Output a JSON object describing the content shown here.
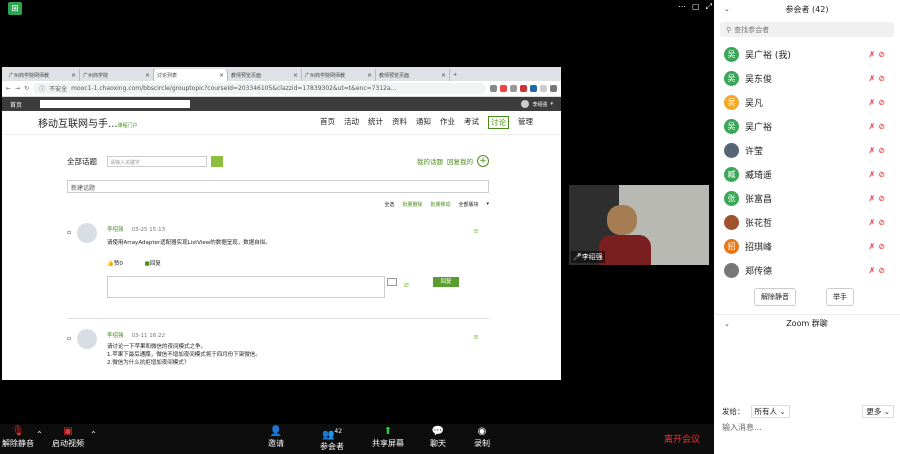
{
  "window": {
    "title_icon": "⊞",
    "controls": [
      "⋯",
      "▢",
      "⤢",
      "⛶"
    ]
  },
  "browser": {
    "tabs": [
      {
        "label": "广州商学院网师教",
        "active": false
      },
      {
        "label": "广州商学院",
        "active": false
      },
      {
        "label": "讨论列表",
        "active": true
      },
      {
        "label": "教师预览页面",
        "active": false
      },
      {
        "label": "广州商学院网师教",
        "active": false
      },
      {
        "label": "教师预览页面",
        "active": false
      }
    ],
    "new_tab": "+",
    "insecure_label": "不安全",
    "url": "mooc1-1.chaoxing.com/bbscircle/grouptopic?courseId=203346105&clazzid=17839302&ut=t&enc=7312a...",
    "site_nav": {
      "home": "首页",
      "user": "李绍强"
    }
  },
  "course": {
    "title": "移动互联网与手...",
    "portal": "课程门户",
    "nav": [
      "首页",
      "活动",
      "统计",
      "资料",
      "通知",
      "作业",
      "考试",
      "讨论",
      "管理"
    ],
    "active_nav": "讨论"
  },
  "discussion": {
    "all_topics": "全部话题",
    "keyword_placeholder": "请输入关键字",
    "my_topics": "我的话题",
    "my_replies": "回复我的",
    "new_topic": "新建话题",
    "select_all": "全选",
    "batch_delete": "批量删除",
    "batch_move": "批量移动",
    "all_sections": "全部版块",
    "reply_btn": "回复",
    "posts": [
      {
        "author": "李绍强",
        "time": "03-25 15:13",
        "text": [
          "请使用ArrayAdapter适配器实现ListView的数据呈现，数据自拟。"
        ],
        "like": "赞0",
        "reply": "回复"
      },
      {
        "author": "李绍强",
        "time": "03-11 16:22",
        "text": [
          "请讨论一下苹果和微信的夜间模式之争。",
          "1.苹果下最后通牒，微信不增加夜间模式将于四月份下架微信。",
          "2.微信为什么抗拒增加夜间模式？"
        ]
      }
    ]
  },
  "video": {
    "name": "李绍强"
  },
  "participants": {
    "title": "参会者 (42)",
    "search_placeholder": "查找参会者",
    "list": [
      {
        "avatar": "吴",
        "name": "吴广裕 (我)",
        "color": "#3aa757"
      },
      {
        "avatar": "吴",
        "name": "吴东俊",
        "color": "#3aa757"
      },
      {
        "avatar": "吴",
        "name": "吴凡",
        "color": "#f5a623"
      },
      {
        "avatar": "吴",
        "name": "吴广裕",
        "color": "#3aa757"
      },
      {
        "avatar": "",
        "name": "许莹",
        "color": "#556677"
      },
      {
        "avatar": "臧",
        "name": "臧琦遥",
        "color": "#3aa757"
      },
      {
        "avatar": "张",
        "name": "张富昌",
        "color": "#3aa757"
      },
      {
        "avatar": "",
        "name": "张花哲",
        "color": "#a0522d"
      },
      {
        "avatar": "招",
        "name": "招琪峰",
        "color": "#e8781a"
      },
      {
        "avatar": "",
        "name": "郑传德",
        "color": "#777777"
      }
    ],
    "unmute_all": "解除静音",
    "raise_hand": "举手"
  },
  "chat": {
    "title": "Zoom 群聊",
    "send_to_label": "发给：",
    "recipient": "所有人",
    "more": "更多",
    "input_placeholder": "输入消息..."
  },
  "toolbar": {
    "unmute": "解除静音",
    "start_video": "启动视频",
    "invite": "邀请",
    "participants": "参会者",
    "participant_count": "42",
    "share": "共享屏幕",
    "chat": "聊天",
    "record": "录制",
    "leave": "离开会议"
  }
}
